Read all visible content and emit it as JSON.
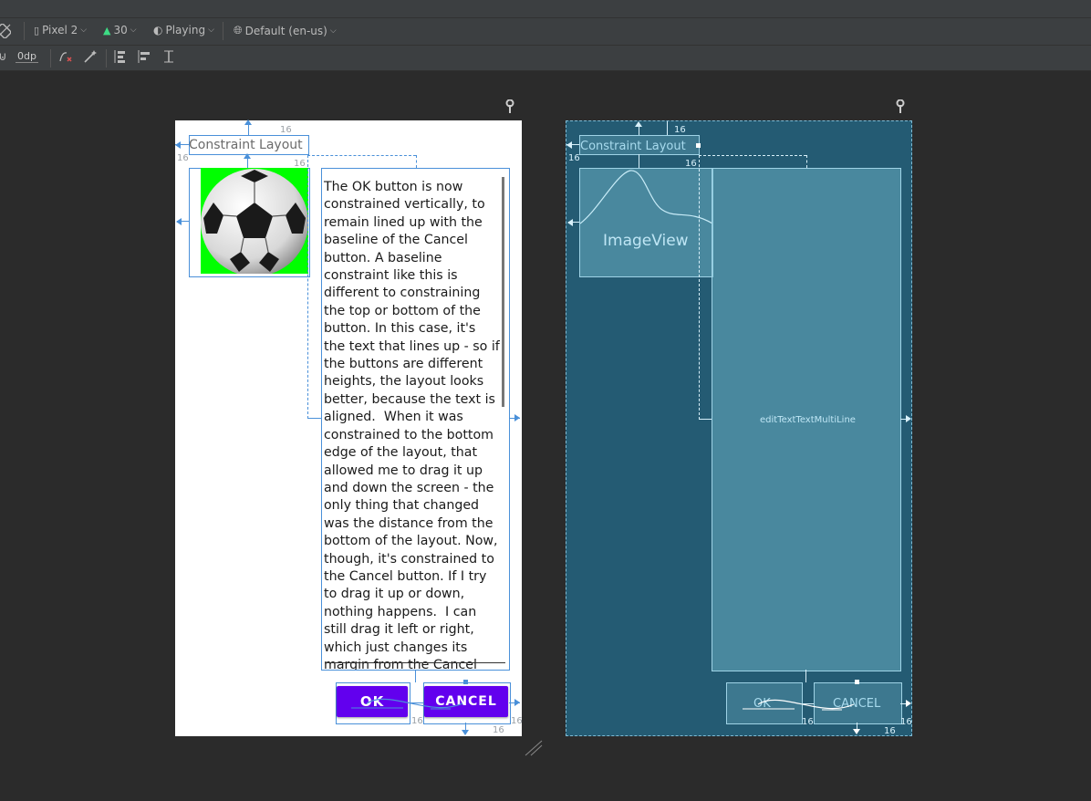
{
  "toolbar": {
    "device": "Pixel 2",
    "api": "30",
    "theme": "Playing",
    "locale": "Default (en-us)",
    "margin": "0dp"
  },
  "design": {
    "title_text": "Constraint Layout",
    "dim_16": "16",
    "body_text": "The OK button is now constrained vertically, to remain lined up with the baseline of the Cancel button. A baseline constraint like this is different to constraining the top or bottom of the button. In this case, it's the text that lines up - so if the buttons are different heights, the layout looks better, because the text is aligned.  When it was constrained to the bottom edge of the layout, that allowed me to drag it up and down the screen - the only thing that changed was the distance from the bottom of the layout. Now, though, it's constrained to the Cancel button. If I try to drag it up or down, nothing happens.  I can still drag it left or right, which just changes its margin from the Cancel button.",
    "ok_label": "OK",
    "cancel_label": "CANCEL"
  },
  "blueprint": {
    "title_text": "Constraint Layout",
    "imageview_label": "ImageView",
    "edittext_label": "editTextTextMultiLine",
    "ok_label": "OK",
    "cancel_label": "CANCEL",
    "dim_16": "16"
  },
  "colors": {
    "button": "#6200ee",
    "constraint": "#4a90d9",
    "blueprint_bg": "#245b73",
    "canvas_bg": "#2b2b2b"
  }
}
